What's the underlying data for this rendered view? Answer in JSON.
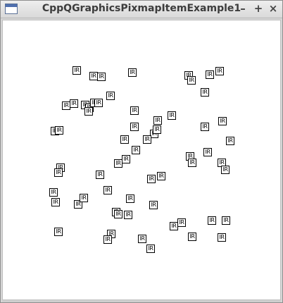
{
  "window": {
    "title": "CppQGraphicsPixmapItemExample1",
    "controls": {
      "minimize": "–",
      "maximize": "+",
      "close": "×"
    }
  },
  "items": [
    {
      "label": "IR"
    },
    {
      "label": "IR"
    },
    {
      "label": "IR"
    },
    {
      "label": "IR"
    },
    {
      "label": "IR"
    },
    {
      "label": "IR"
    },
    {
      "label": "IR"
    },
    {
      "label": "IR"
    },
    {
      "label": "IR"
    },
    {
      "label": "IR"
    },
    {
      "label": "IR"
    },
    {
      "label": "IR"
    },
    {
      "label": "IR"
    },
    {
      "label": "IR"
    },
    {
      "label": "IR"
    },
    {
      "label": "IR"
    },
    {
      "label": "IR"
    },
    {
      "label": "IR"
    },
    {
      "label": "IR"
    },
    {
      "label": "IR"
    },
    {
      "label": "IR"
    },
    {
      "label": "IR"
    },
    {
      "label": "IR"
    },
    {
      "label": "IR"
    },
    {
      "label": "IR"
    },
    {
      "label": "IR"
    },
    {
      "label": "IR"
    },
    {
      "label": "IR"
    },
    {
      "label": "IR"
    },
    {
      "label": "IR"
    },
    {
      "label": "IR"
    },
    {
      "label": "IR"
    },
    {
      "label": "IR"
    },
    {
      "label": "IR"
    },
    {
      "label": "IR"
    },
    {
      "label": "IR"
    },
    {
      "label": "IR"
    },
    {
      "label": "IR"
    },
    {
      "label": "IR"
    },
    {
      "label": "IR"
    },
    {
      "label": "IR"
    },
    {
      "label": "IR"
    },
    {
      "label": "IR"
    },
    {
      "label": "IR"
    },
    {
      "label": "IR"
    },
    {
      "label": "IR"
    },
    {
      "label": "IR"
    },
    {
      "label": "IR"
    },
    {
      "label": "IR"
    },
    {
      "label": "IR"
    },
    {
      "label": "IR"
    },
    {
      "label": "IR"
    },
    {
      "label": "IR"
    },
    {
      "label": "IR"
    },
    {
      "label": "IR"
    },
    {
      "label": "IR"
    },
    {
      "label": "IR"
    },
    {
      "label": "IR"
    },
    {
      "label": "IR"
    },
    {
      "label": "IR"
    },
    {
      "label": "IR"
    },
    {
      "label": "IR"
    },
    {
      "label": "IR"
    },
    {
      "label": "IR"
    },
    {
      "label": "IR"
    },
    {
      "label": "IR"
    },
    {
      "label": "IR"
    },
    {
      "label": "IR"
    },
    {
      "label": "IR"
    },
    {
      "label": "IR"
    },
    {
      "label": "IR"
    },
    {
      "label": "IR"
    },
    {
      "label": "IR"
    },
    {
      "label": "IR"
    }
  ]
}
